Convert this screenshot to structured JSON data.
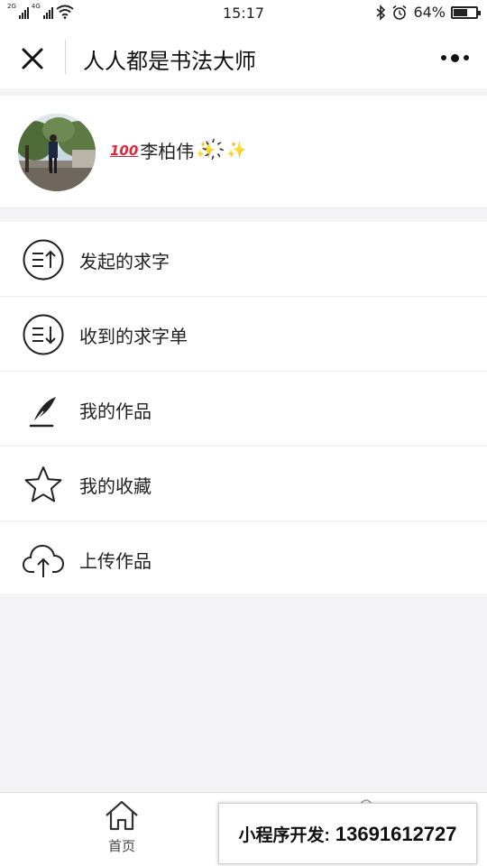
{
  "status_bar": {
    "network_1": "2G",
    "network_2": "4G",
    "time": "15:17",
    "battery_percent": "64%",
    "battery_level": 0.64
  },
  "nav": {
    "title": "人人都是书法大师"
  },
  "profile": {
    "badge": "100",
    "nickname": "李柏伟",
    "sparkle": "✨",
    "mid_emoji": "҉"
  },
  "menu": {
    "items": [
      {
        "label": "发起的求字",
        "icon": "list-upload-icon"
      },
      {
        "label": "收到的求字单",
        "icon": "list-download-icon"
      },
      {
        "label": "我的作品",
        "icon": "quill-icon"
      },
      {
        "label": "我的收藏",
        "icon": "star-icon"
      },
      {
        "label": "上传作品",
        "icon": "cloud-upload-icon"
      }
    ]
  },
  "tabbar": {
    "home_label": "首页"
  },
  "promo": {
    "prefix": "小程序开发:",
    "phone": "13691612727"
  }
}
